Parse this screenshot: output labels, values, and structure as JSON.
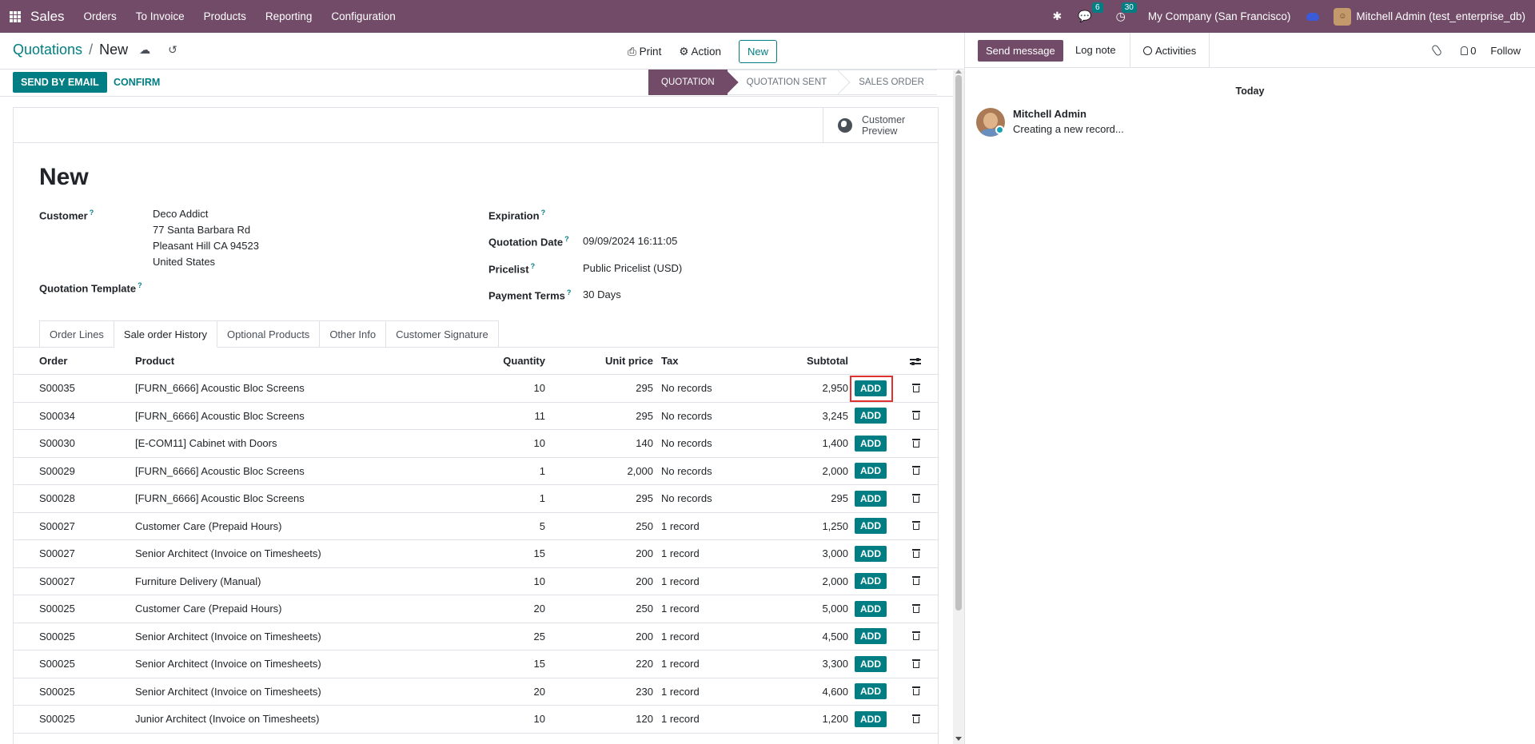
{
  "topbar": {
    "app_name": "Sales",
    "menu": [
      "Orders",
      "To Invoice",
      "Products",
      "Reporting",
      "Configuration"
    ],
    "messages_count": "6",
    "activities_count": "30",
    "company": "My Company (San Francisco)",
    "user": "Mitchell Admin (test_enterprise_db)",
    "brand_color": "#714b67"
  },
  "control": {
    "breadcrumb_parent": "Quotations",
    "breadcrumb_current": "New",
    "print_label": "Print",
    "action_label": "Action",
    "new_label": "New"
  },
  "status": {
    "send_email": "SEND BY EMAIL",
    "confirm": "CONFIRM",
    "stages": [
      "QUOTATION",
      "QUOTATION SENT",
      "SALES ORDER"
    ],
    "active_stage": "QUOTATION"
  },
  "form": {
    "preview_label": "Customer Preview",
    "title": "New",
    "customer_label": "Customer",
    "customer_lines": [
      "Deco Addict",
      "77 Santa Barbara Rd",
      "Pleasant Hill CA 94523",
      "United States"
    ],
    "template_label": "Quotation Template",
    "expiration_label": "Expiration",
    "quotation_date_label": "Quotation Date",
    "quotation_date": "09/09/2024 16:11:05",
    "pricelist_label": "Pricelist",
    "pricelist": "Public Pricelist (USD)",
    "payment_terms_label": "Payment Terms",
    "payment_terms": "30 Days",
    "help_mark": "?"
  },
  "tabs": [
    "Order Lines",
    "Sale order History",
    "Optional Products",
    "Other Info",
    "Customer Signature"
  ],
  "active_tab": "Sale order History",
  "table": {
    "headers": {
      "order": "Order",
      "product": "Product",
      "quantity": "Quantity",
      "unit_price": "Unit price",
      "tax": "Tax",
      "subtotal": "Subtotal"
    },
    "add_label": "ADD",
    "rows": [
      {
        "order": "S00035",
        "product": "[FURN_6666] Acoustic Bloc Screens",
        "quantity": "10",
        "unit_price": "295",
        "tax": "No records",
        "subtotal": "2,950"
      },
      {
        "order": "S00034",
        "product": "[FURN_6666] Acoustic Bloc Screens",
        "quantity": "11",
        "unit_price": "295",
        "tax": "No records",
        "subtotal": "3,245"
      },
      {
        "order": "S00030",
        "product": "[E-COM11] Cabinet with Doors",
        "quantity": "10",
        "unit_price": "140",
        "tax": "No records",
        "subtotal": "1,400"
      },
      {
        "order": "S00029",
        "product": "[FURN_6666] Acoustic Bloc Screens",
        "quantity": "1",
        "unit_price": "2,000",
        "tax": "No records",
        "subtotal": "2,000"
      },
      {
        "order": "S00028",
        "product": "[FURN_6666] Acoustic Bloc Screens",
        "quantity": "1",
        "unit_price": "295",
        "tax": "No records",
        "subtotal": "295"
      },
      {
        "order": "S00027",
        "product": "Customer Care (Prepaid Hours)",
        "quantity": "5",
        "unit_price": "250",
        "tax": "1 record",
        "subtotal": "1,250"
      },
      {
        "order": "S00027",
        "product": "Senior Architect (Invoice on Timesheets)",
        "quantity": "15",
        "unit_price": "200",
        "tax": "1 record",
        "subtotal": "3,000"
      },
      {
        "order": "S00027",
        "product": "Furniture Delivery (Manual)",
        "quantity": "10",
        "unit_price": "200",
        "tax": "1 record",
        "subtotal": "2,000"
      },
      {
        "order": "S00025",
        "product": "Customer Care (Prepaid Hours)",
        "quantity": "20",
        "unit_price": "250",
        "tax": "1 record",
        "subtotal": "5,000"
      },
      {
        "order": "S00025",
        "product": "Senior Architect (Invoice on Timesheets)",
        "quantity": "25",
        "unit_price": "200",
        "tax": "1 record",
        "subtotal": "4,500"
      },
      {
        "order": "S00025",
        "product": "Senior Architect (Invoice on Timesheets)",
        "quantity": "15",
        "unit_price": "220",
        "tax": "1 record",
        "subtotal": "3,300"
      },
      {
        "order": "S00025",
        "product": "Senior Architect (Invoice on Timesheets)",
        "quantity": "20",
        "unit_price": "230",
        "tax": "1 record",
        "subtotal": "4,600"
      },
      {
        "order": "S00025",
        "product": "Junior Architect (Invoice on Timesheets)",
        "quantity": "10",
        "unit_price": "120",
        "tax": "1 record",
        "subtotal": "1,200"
      }
    ]
  },
  "chatter": {
    "send_message": "Send message",
    "log_note": "Log note",
    "activities": "Activities",
    "followers": "0",
    "follow": "Follow",
    "day": "Today",
    "author": "Mitchell Admin",
    "body": "Creating a new record..."
  }
}
